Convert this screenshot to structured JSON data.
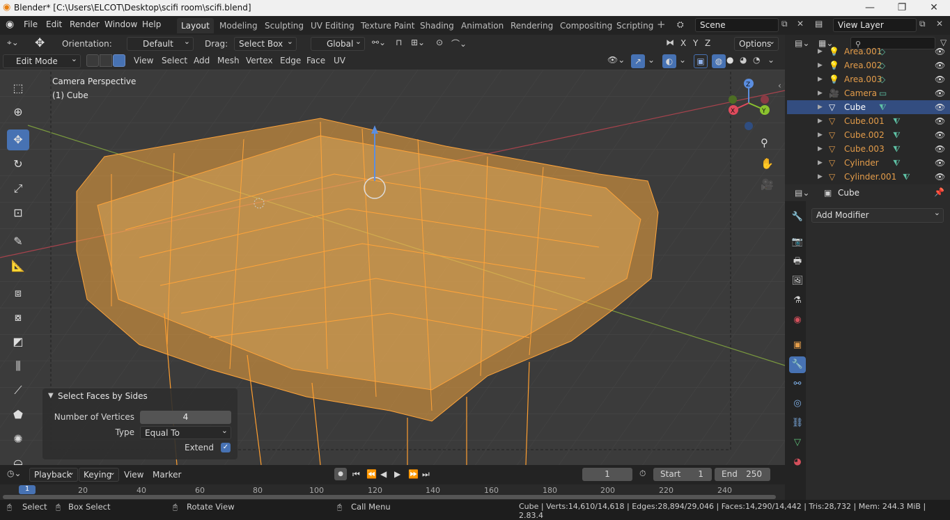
{
  "title": "Blender* [C:\\Users\\ELCOT\\Desktop\\scifi room\\scifi.blend]",
  "menus": [
    "File",
    "Edit",
    "Render",
    "Window",
    "Help"
  ],
  "workspaces": [
    "Layout",
    "Modeling",
    "Sculpting",
    "UV Editing",
    "Texture Paint",
    "Shading",
    "Animation",
    "Rendering",
    "Compositing",
    "Scripting"
  ],
  "scene": "Scene",
  "view_layer": "View Layer",
  "toolheader": {
    "orientation_label": "Orientation:",
    "orientation_value": "Default",
    "drag_label": "Drag:",
    "drag_value": "Select Box",
    "transform": "Global",
    "options": "Options",
    "axes": [
      "X",
      "Y",
      "Z"
    ]
  },
  "editheader": {
    "mode": "Edit Mode",
    "items": [
      "View",
      "Select",
      "Add",
      "Mesh",
      "Vertex",
      "Edge",
      "Face",
      "UV"
    ]
  },
  "viewport": {
    "perspective": "Camera Perspective",
    "object": "(1) Cube"
  },
  "gizmo": {
    "x": "X",
    "y": "Y",
    "z": "Z"
  },
  "operator_panel": {
    "title": "Select Faces by Sides",
    "num_vertices_label": "Number of Vertices",
    "num_vertices_value": "4",
    "type_label": "Type",
    "type_value": "Equal To",
    "extend_label": "Extend",
    "extend_checked": true
  },
  "outliner": [
    {
      "name": "Area.001",
      "kind": "light"
    },
    {
      "name": "Area.002",
      "kind": "light"
    },
    {
      "name": "Area.003",
      "kind": "light"
    },
    {
      "name": "Camera",
      "kind": "camera"
    },
    {
      "name": "Cube",
      "kind": "mesh",
      "selected": true
    },
    {
      "name": "Cube.001",
      "kind": "mesh"
    },
    {
      "name": "Cube.002",
      "kind": "mesh"
    },
    {
      "name": "Cube.003",
      "kind": "mesh"
    },
    {
      "name": "Cylinder",
      "kind": "mesh"
    },
    {
      "name": "Cylinder.001",
      "kind": "mesh"
    }
  ],
  "properties": {
    "object": "Cube",
    "add_modifier": "Add Modifier"
  },
  "timeline": {
    "playback": "Playback",
    "keying": "Keying",
    "view": "View",
    "marker": "Marker",
    "current_frame": "1",
    "start_label": "Start",
    "start": "1",
    "end_label": "End",
    "end": "250",
    "ticks": [
      "1",
      "20",
      "40",
      "60",
      "80",
      "100",
      "120",
      "140",
      "160",
      "180",
      "200",
      "220",
      "240"
    ]
  },
  "status": {
    "select": "Select",
    "box_select": "Box Select",
    "rotate": "Rotate View",
    "call_menu": "Call Menu",
    "stats": "Cube | Verts:14,610/14,618 | Edges:28,894/29,046 | Faces:14,290/14,442 | Tris:28,732 | Mem: 244.3 MiB | 2.83.4"
  },
  "colors": {
    "accent": "#4772b3",
    "selection": "#ffa43a",
    "selected_row": "#334d80",
    "object_name": "#e39c4a"
  }
}
